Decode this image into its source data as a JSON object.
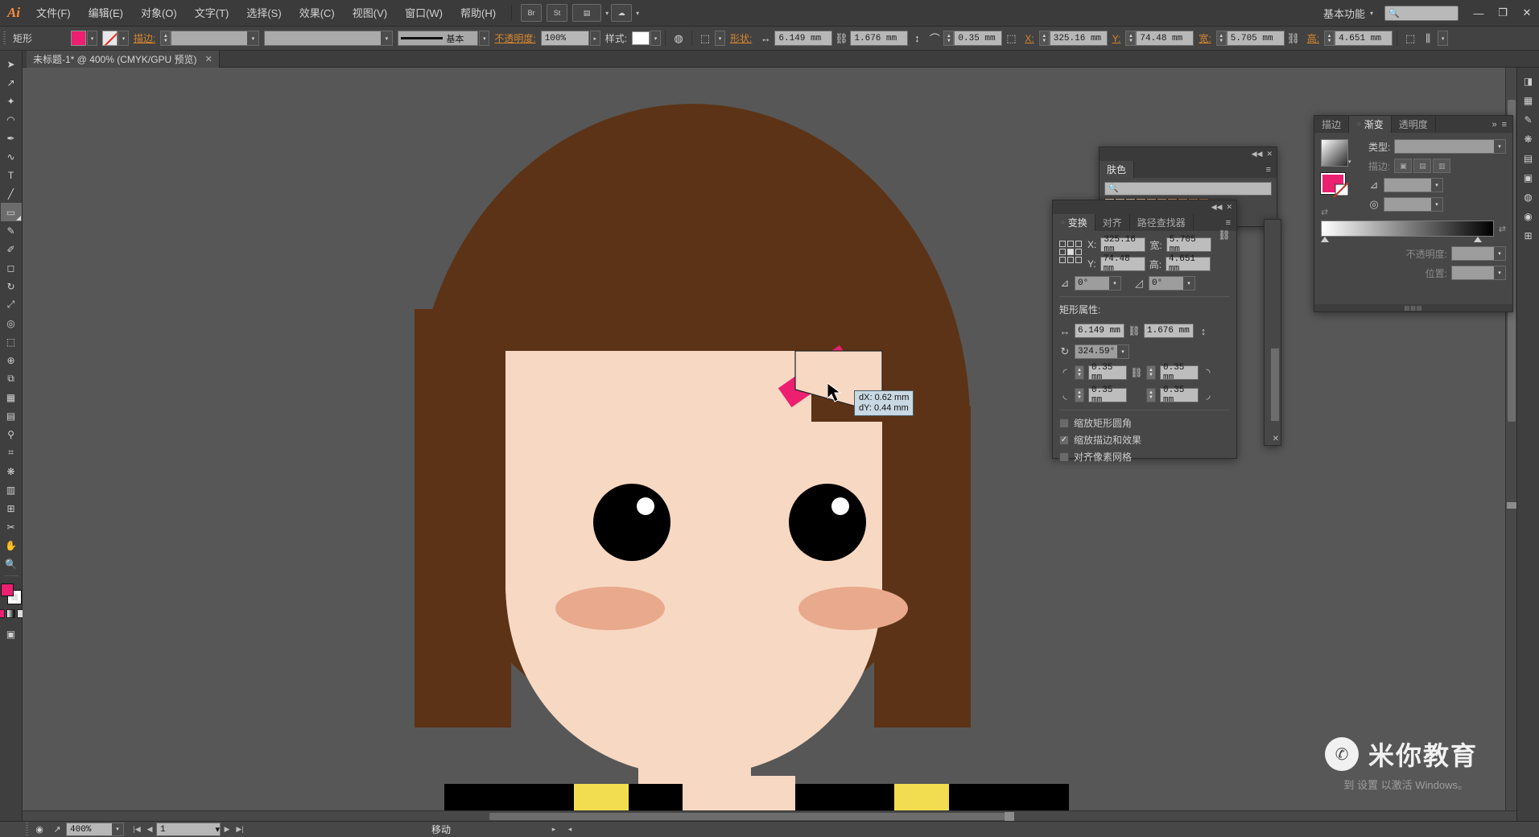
{
  "app": {
    "name": "Adobe Illustrator",
    "logo_text": "Ai"
  },
  "menubar": {
    "items": [
      {
        "label": "文件(F)",
        "name": "menu-file"
      },
      {
        "label": "编辑(E)",
        "name": "menu-edit"
      },
      {
        "label": "对象(O)",
        "name": "menu-object"
      },
      {
        "label": "文字(T)",
        "name": "menu-type"
      },
      {
        "label": "选择(S)",
        "name": "menu-select"
      },
      {
        "label": "效果(C)",
        "name": "menu-effect"
      },
      {
        "label": "视图(V)",
        "name": "menu-view"
      },
      {
        "label": "窗口(W)",
        "name": "menu-window"
      },
      {
        "label": "帮助(H)",
        "name": "menu-help"
      }
    ],
    "bridge_label": "Br",
    "stock_label": "St",
    "arrange_label": "▤",
    "sync_label": "☁",
    "workspace": "基本功能",
    "search_placeholder": "",
    "window_min": "—",
    "window_restore": "❐",
    "window_close": "✕"
  },
  "controlbar": {
    "object_type": "矩形",
    "fill_color": "#ec1f70",
    "stroke_color": "none",
    "stroke_label": "描边:",
    "stroke_weight": "",
    "stroke_profile": "",
    "brush_name": "基本",
    "opacity_label": "不透明度:",
    "opacity_value": "100%",
    "style_label": "样式:",
    "style_swatch": "#ffffff",
    "shape_label": "形状:",
    "width_value": "6.149 mm",
    "height_value": "1.676 mm",
    "corner_value": "0.35 mm",
    "x_label": "X:",
    "x_value": "325.16 mm",
    "y_label": "Y:",
    "y_value": "74.48 mm",
    "w_value": "5.705 mm",
    "h_value": "4.651 mm",
    "link_icon": "⛓"
  },
  "tabbar": {
    "document_title": "未标题-1* @ 400% (CMYK/GPU 预览)",
    "close_label": "✕"
  },
  "toolbox": {
    "tools": [
      {
        "name": "tool-selection",
        "glyph": "➤",
        "active": false
      },
      {
        "name": "tool-direct-selection",
        "glyph": "↗",
        "active": false
      },
      {
        "name": "tool-magic-wand",
        "glyph": "✦",
        "active": false
      },
      {
        "name": "tool-lasso",
        "glyph": "◡",
        "active": false
      },
      {
        "name": "tool-pen",
        "glyph": "✒",
        "active": false
      },
      {
        "name": "tool-curvature",
        "glyph": "～",
        "active": false
      },
      {
        "name": "tool-type",
        "glyph": "T",
        "active": false
      },
      {
        "name": "tool-line-segment",
        "glyph": "╱",
        "active": false
      },
      {
        "name": "tool-rectangle",
        "glyph": "▭",
        "active": true
      },
      {
        "name": "tool-paintbrush",
        "glyph": "🖌",
        "active": false
      },
      {
        "name": "tool-shaper",
        "glyph": "✐",
        "active": false
      },
      {
        "name": "tool-eraser",
        "glyph": "◻",
        "active": false
      },
      {
        "name": "tool-rotate",
        "glyph": "↻",
        "active": false
      },
      {
        "name": "tool-scale",
        "glyph": "⤢",
        "active": false
      },
      {
        "name": "tool-width",
        "glyph": "◎",
        "active": false
      },
      {
        "name": "tool-free-transform",
        "glyph": "⬚",
        "active": false
      },
      {
        "name": "tool-shape-builder",
        "glyph": "⊕",
        "active": false
      },
      {
        "name": "tool-perspective-grid",
        "glyph": "⧉",
        "active": false
      },
      {
        "name": "tool-mesh",
        "glyph": "▦",
        "active": false
      },
      {
        "name": "tool-gradient",
        "glyph": "▤",
        "active": false
      },
      {
        "name": "tool-eyedropper",
        "glyph": "⚲",
        "active": false
      },
      {
        "name": "tool-blend",
        "glyph": "⌗",
        "active": false
      },
      {
        "name": "tool-symbol-sprayer",
        "glyph": "❋",
        "active": false
      },
      {
        "name": "tool-column-graph",
        "glyph": "▥",
        "active": false
      },
      {
        "name": "tool-artboard",
        "glyph": "⊞",
        "active": false
      },
      {
        "name": "tool-slice",
        "glyph": "✂",
        "active": false
      },
      {
        "name": "tool-hand",
        "glyph": "✋",
        "active": false
      },
      {
        "name": "tool-zoom",
        "glyph": "🔍",
        "active": false
      }
    ],
    "fill_color": "#ec1f70",
    "stroke_color": "#ffffff",
    "screen_mode_glyph": "▣"
  },
  "skin_panel": {
    "title": "肤色",
    "search_placeholder": "",
    "swatches": [
      "#f6e0cd",
      "#f3d6bd",
      "#efc9a9",
      "#eabd97",
      "#e4b087",
      "#dfa377",
      "#d99868",
      "#c98d62",
      "#b98057",
      "#a8734e"
    ]
  },
  "transform_panel": {
    "tabs": [
      {
        "label": "变换",
        "active": true,
        "name": "tab-transform"
      },
      {
        "label": "对齐",
        "active": false,
        "name": "tab-align"
      },
      {
        "label": "路径查找器",
        "active": false,
        "name": "tab-pathfinder"
      }
    ],
    "x_label": "X:",
    "x_value": "325.16 mm",
    "y_label": "Y:",
    "y_value": "74.48 mm",
    "w_label": "宽:",
    "w_value": "5.705 mm",
    "h_label": "高:",
    "h_value": "4.651 mm",
    "shear_label": "⊿:",
    "angle_value": "0°",
    "rotate_label": "⌂:",
    "rotate_value": "0°",
    "section_title": "矩形属性:",
    "rect_width": "6.149 mm",
    "rect_height": "1.676 mm",
    "rect_angle": "324.59°",
    "corner_tl": "0.35 mm",
    "corner_tr": "0.35 mm",
    "corner_bl": "0.35 mm",
    "corner_br": "0.35 mm",
    "checkboxes": [
      {
        "label": "缩放矩形圆角",
        "checked": false,
        "name": "checkbox-scale-rect-corners"
      },
      {
        "label": "缩放描边和效果",
        "checked": true,
        "name": "checkbox-scale-strokes-effects"
      },
      {
        "label": "对齐像素网格",
        "checked": false,
        "name": "checkbox-align-pixel-grid"
      }
    ],
    "check_glyph": "✓"
  },
  "gradient_panel": {
    "tabs": [
      {
        "label": "描边",
        "active": false,
        "name": "tab-stroke"
      },
      {
        "label": "渐变",
        "active": true,
        "name": "tab-gradient"
      },
      {
        "label": "透明度",
        "active": false,
        "name": "tab-transparency"
      }
    ],
    "type_label": "类型:",
    "type_value": "",
    "stroke_label": "描边:",
    "angle_label": "⊿:",
    "angle_value": "",
    "aspect_label": "纵横比:",
    "aspect_value": "",
    "reverse_label": "⇄",
    "opacity_label": "不透明度:",
    "opacity_value": "",
    "location_label": "位置:",
    "location_value": "",
    "gradient_from": "#ffffff",
    "gradient_to": "#000000"
  },
  "canvas": {
    "artwork_name": "girl-avatar-illustration",
    "hair_color": "#5c3317",
    "skin_color": "#f7d8c3",
    "cheek_color": "#e8a98d",
    "eye_color": "#000000",
    "eye_highlight": "#ffffff",
    "shirt_color": "#000000",
    "stripe_color": "#f2dd51",
    "selected_rect_color": "#ec1f70"
  },
  "tooltip": {
    "dx": "dX: 0.62 mm",
    "dy": "dY: 0.44 mm"
  },
  "statusbar": {
    "zoom_value": "400%",
    "page_value": "1",
    "status_text": "移动",
    "first_glyph": "|◀",
    "prev_glyph": "◀",
    "next_glyph": "▶",
    "last_glyph": "▶|",
    "camera_glyph": "◉",
    "share_glyph": "↗"
  },
  "watermark": {
    "icon": "✆",
    "text": "米你教育",
    "activate_text": "到 设置 以激活 Windows。"
  },
  "dock": {
    "icons": [
      {
        "name": "dock-color-icon",
        "glyph": "◨"
      },
      {
        "name": "dock-swatches-icon",
        "glyph": "▦"
      },
      {
        "name": "dock-brushes-icon",
        "glyph": "✎"
      },
      {
        "name": "dock-symbols-icon",
        "glyph": "❋"
      },
      {
        "name": "dock-layers-icon",
        "glyph": "▤"
      },
      {
        "name": "dock-libraries-icon",
        "glyph": "▣"
      },
      {
        "name": "dock-appearance-icon",
        "glyph": "◍"
      },
      {
        "name": "dock-graphic-styles-icon",
        "glyph": "◉"
      },
      {
        "name": "dock-artboards-icon",
        "glyph": "⊞"
      }
    ]
  }
}
